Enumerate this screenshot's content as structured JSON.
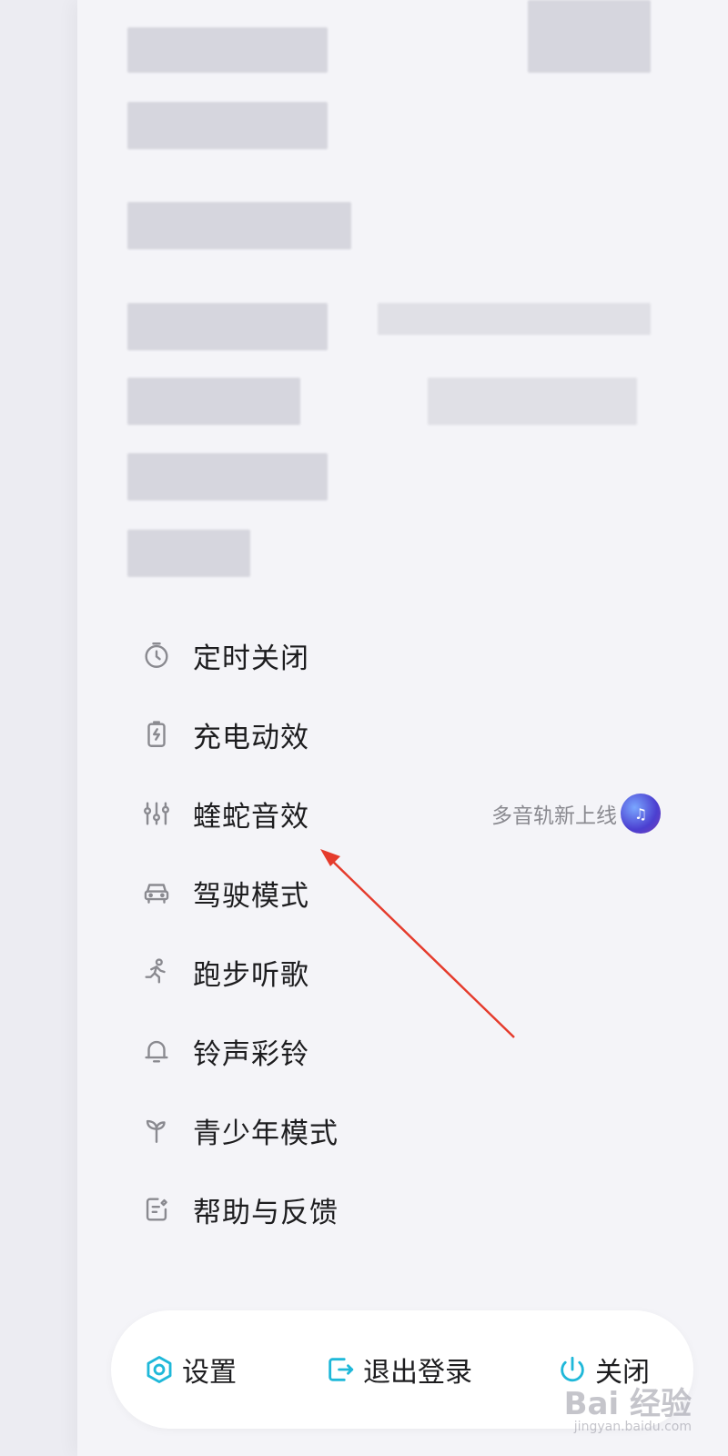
{
  "menu": {
    "items": [
      {
        "label": "定时关闭",
        "icon": "timer-icon"
      },
      {
        "label": "充电动效",
        "icon": "charging-icon"
      },
      {
        "label": "蝰蛇音效",
        "icon": "equalizer-icon",
        "badge_text": "多音轨新上线"
      },
      {
        "label": "驾驶模式",
        "icon": "car-icon"
      },
      {
        "label": "跑步听歌",
        "icon": "running-icon"
      },
      {
        "label": "铃声彩铃",
        "icon": "bell-icon"
      },
      {
        "label": "青少年模式",
        "icon": "sprout-icon"
      },
      {
        "label": "帮助与反馈",
        "icon": "feedback-icon"
      }
    ]
  },
  "bottom_bar": {
    "settings_label": "设置",
    "logout_label": "退出登录",
    "close_label": "关闭"
  },
  "watermark": {
    "text": "Bai 经验",
    "sub": "jingyan.baidu.com"
  },
  "colors": {
    "accent": "#1fb8d9",
    "icon_gray": "#8a8a90",
    "annotation_arrow": "#e53b2c"
  }
}
